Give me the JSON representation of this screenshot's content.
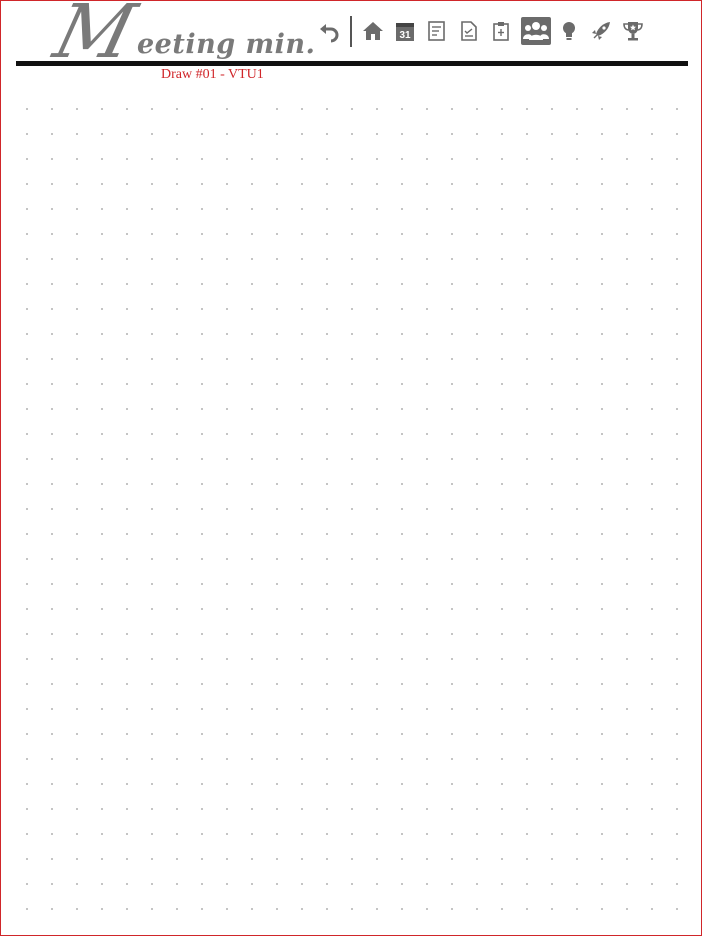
{
  "header": {
    "title_initial": "M",
    "title_rest": "eeting min.",
    "subtitle": "Draw #01 - VTU1",
    "calendar_day": "31"
  },
  "toolbar": {
    "undo_icon": "undo-icon",
    "items": [
      {
        "icon": "home-icon"
      },
      {
        "icon": "calendar-icon"
      },
      {
        "icon": "notes-icon"
      },
      {
        "icon": "checklist-document-icon"
      },
      {
        "icon": "clipboard-icon"
      },
      {
        "icon": "people-icon",
        "active": true
      },
      {
        "icon": "lightbulb-icon"
      },
      {
        "icon": "rocket-icon"
      },
      {
        "icon": "trophy-icon"
      }
    ]
  },
  "colors": {
    "accent": "#d0262a",
    "icon": "#6b6b6b",
    "rule": "#111111",
    "dots": "#9a9a9a"
  }
}
